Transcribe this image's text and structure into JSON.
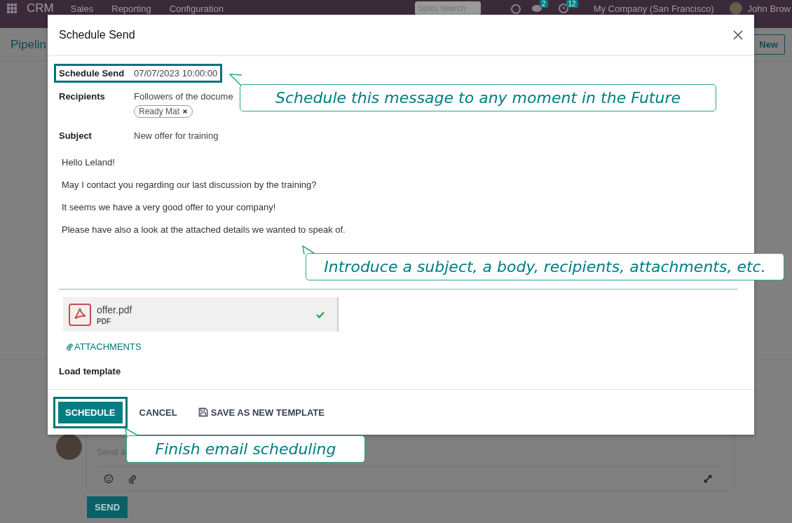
{
  "navbar": {
    "app": "CRM",
    "menus": [
      "Sales",
      "Reporting",
      "Configuration"
    ],
    "search_placeholder": "tasks search",
    "messages_badge": "2",
    "activities_badge": "12",
    "company": "My Company (San Francisco)",
    "user": "John Brow"
  },
  "page": {
    "breadcrumb": "Pipelin",
    "new_button": "New"
  },
  "chatter": {
    "placeholder": "Send a",
    "send_button": "SEND"
  },
  "dialog": {
    "title": "Schedule Send",
    "fields": [
      {
        "label": "Schedule Send",
        "value": "07/07/2023 10:00:00",
        "highlighted": true
      },
      {
        "label": "Recipients",
        "value": "Followers of the docume",
        "highlighted": false,
        "tags": [
          "Ready Mat"
        ]
      },
      {
        "label": "Subject",
        "value": "New offer for training",
        "highlighted": false
      }
    ],
    "body": [
      "Hello Leland!",
      "May I contact you regarding our last discussion by the training?",
      "It seems we have a very good offer to your company!",
      "Please have also a look at the attached details we wanted to speak of."
    ],
    "attachments": [
      {
        "name": "offer.pdf",
        "type": "PDF",
        "uploaded": true
      }
    ],
    "attach_link": "ATTACHMENTS",
    "load_template": "Load template",
    "buttons": [
      {
        "label": "SCHEDULE",
        "kind": "primary",
        "highlighted": true
      },
      {
        "label": "CANCEL",
        "kind": "secondary",
        "highlighted": false
      },
      {
        "label": "SAVE AS NEW TEMPLATE",
        "kind": "save",
        "highlighted": false
      }
    ]
  },
  "callouts": [
    "Schedule this message to any moment in the Future",
    "Introduce a subject, a body, recipients, attachments, etc.",
    "Finish email scheduling"
  ]
}
